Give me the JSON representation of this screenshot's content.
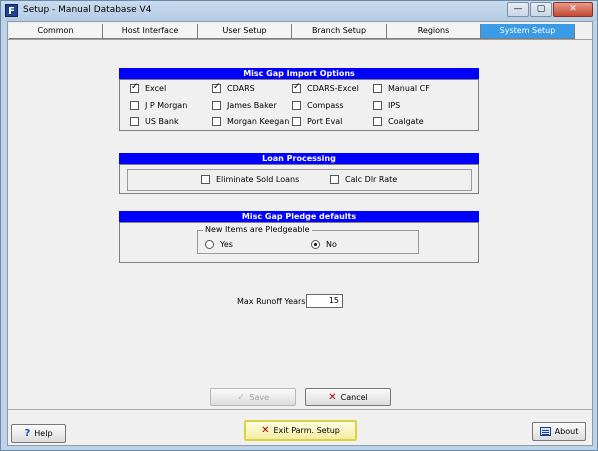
{
  "window": {
    "title": "Setup - Manual Database V4",
    "app_icon_glyph": "F",
    "minimize_glyph": "—",
    "restore_glyph": "▢",
    "close_glyph": "✕"
  },
  "tabs": [
    {
      "label": "Common"
    },
    {
      "label": "Host Interface"
    },
    {
      "label": "User Setup"
    },
    {
      "label": "Branch Setup"
    },
    {
      "label": "Regions"
    },
    {
      "label": "System Setup"
    }
  ],
  "sections": {
    "misc_gap_import_options": {
      "title": "Misc Gap Import Options",
      "items": [
        {
          "label": "Excel",
          "checked": true
        },
        {
          "label": "CDARS",
          "checked": true
        },
        {
          "label": "CDARS-Excel",
          "checked": true
        },
        {
          "label": "Manual CF",
          "checked": false
        },
        {
          "label": "J P Morgan",
          "checked": false
        },
        {
          "label": "James Baker",
          "checked": false
        },
        {
          "label": "Compass",
          "checked": false
        },
        {
          "label": "IPS",
          "checked": false
        },
        {
          "label": "US Bank",
          "checked": false
        },
        {
          "label": "Morgan Keegan",
          "checked": false
        },
        {
          "label": "Port Eval",
          "checked": false
        },
        {
          "label": "Coalgate",
          "checked": false
        }
      ]
    },
    "loan_processing": {
      "title": "Loan Processing",
      "items": [
        {
          "label": "Eliminate Sold Loans",
          "checked": false
        },
        {
          "label": "Calc Dlr Rate",
          "checked": false
        }
      ]
    },
    "misc_gap_pledge_defaults": {
      "title": "Misc Gap Pledge defaults",
      "group_label": "New Items are Pledgeable",
      "options": [
        {
          "label": "Yes",
          "selected": false
        },
        {
          "label": "No",
          "selected": true
        }
      ]
    }
  },
  "max_runoff": {
    "label": "Max Runoff Years",
    "value": "15"
  },
  "buttons": {
    "save": "Save",
    "cancel": "Cancel",
    "help": "Help",
    "exit": "Exit Parm. Setup",
    "about": "About"
  },
  "colors": {
    "section_header": "#0000ff",
    "active_tab": "#3a9be8",
    "focus_border": "#d8d440"
  }
}
